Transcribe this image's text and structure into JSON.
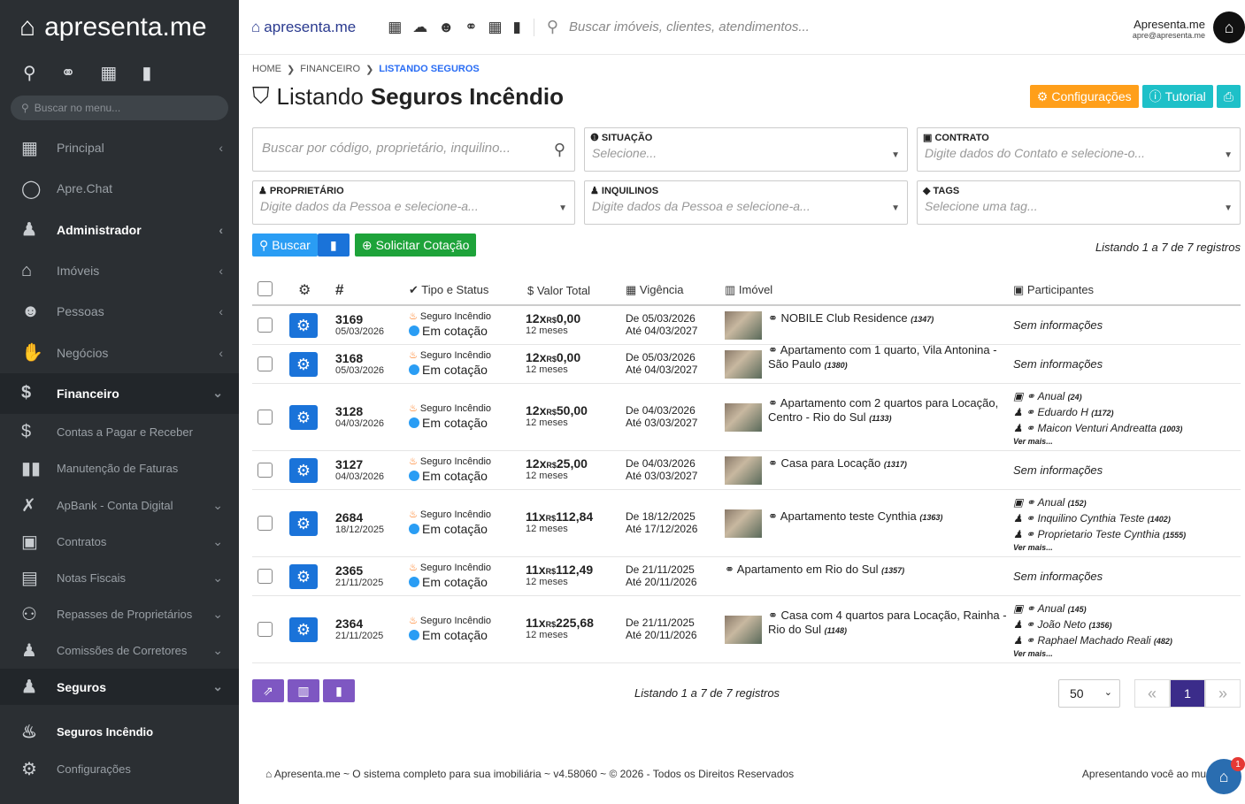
{
  "sidebar": {
    "logo": "apresenta.me",
    "search_placeholder": "Buscar no menu...",
    "items": [
      {
        "label": "Principal",
        "icon": "dashboard-icon",
        "glyph": "▦",
        "arrow": "‹",
        "style": ""
      },
      {
        "label": "Apre.Chat",
        "icon": "whatsapp-icon",
        "glyph": "◯",
        "arrow": "",
        "style": ""
      },
      {
        "label": "Administrador",
        "icon": "admin-icon",
        "glyph": "♟",
        "arrow": "‹",
        "style": "bold"
      },
      {
        "label": "Imóveis",
        "icon": "home-icon",
        "glyph": "⌂",
        "arrow": "‹",
        "style": ""
      },
      {
        "label": "Pessoas",
        "icon": "people-icon",
        "glyph": "☻",
        "arrow": "‹",
        "style": ""
      },
      {
        "label": "Negócios",
        "icon": "handshake-icon",
        "glyph": "✋",
        "arrow": "‹",
        "style": ""
      },
      {
        "label": "Financeiro",
        "icon": "money-icon",
        "glyph": "$",
        "arrow": "⌄",
        "style": "open"
      }
    ],
    "sub_items": [
      {
        "label": "Contas a Pagar e Receber",
        "icon": "dollar-icon",
        "glyph": "$",
        "arrow": ""
      },
      {
        "label": "Manutenção de Faturas",
        "icon": "barcode-icon",
        "glyph": "▮▮",
        "arrow": ""
      },
      {
        "label": "ApBank - Conta Digital",
        "icon": "bank-icon",
        "glyph": "✗",
        "arrow": "⌄"
      },
      {
        "label": "Contratos",
        "icon": "contract-icon",
        "glyph": "▣",
        "arrow": "⌄"
      },
      {
        "label": "Notas Fiscais",
        "icon": "invoice-icon",
        "glyph": "▤",
        "arrow": "⌄"
      },
      {
        "label": "Repasses de Proprietários",
        "icon": "transfer-icon",
        "glyph": "⚇",
        "arrow": "⌄"
      },
      {
        "label": "Comissões de Corretores",
        "icon": "commission-icon",
        "glyph": "♟",
        "arrow": "⌄"
      }
    ],
    "seguros": {
      "label": "Seguros",
      "arrow": "⌄"
    },
    "seguros_incendio": "Seguros Incêndio",
    "configuracoes": "Configurações"
  },
  "topbar": {
    "logo": "apresenta.me",
    "search_placeholder": "Buscar imóveis, clientes, atendimentos...",
    "user_name": "Apresenta.me",
    "user_email": "apre@apresenta.me"
  },
  "breadcrumb": {
    "home": "HOME",
    "sep": "❯",
    "fin": "FINANCEIRO",
    "cur": "LISTANDO SEGUROS"
  },
  "title": {
    "light": "Listando",
    "bold": "Seguros Incêndio"
  },
  "buttons": {
    "config": "Configurações",
    "tutorial": "Tutorial",
    "buscar": "Buscar",
    "cotacao": "Solicitar Cotação"
  },
  "filters": {
    "search_placeholder": "Buscar por código, proprietário, inquilino...",
    "situacao": {
      "label": "SITUAÇÃO",
      "ph": "Selecione..."
    },
    "contrato": {
      "label": "CONTRATO",
      "ph": "Digite dados do Contato e selecione-o..."
    },
    "proprietario": {
      "label": "PROPRIETÁRIO",
      "ph": "Digite dados da Pessoa e selecione-a..."
    },
    "inquilinos": {
      "label": "INQUILINOS",
      "ph": "Digite dados da Pessoa e selecione-a..."
    },
    "tags": {
      "label": "TAGS",
      "ph": "Selecione uma tag..."
    }
  },
  "count_text": "Listando 1 a 7 de 7 registros",
  "columns": {
    "hash": "#",
    "tipo": "Tipo e Status",
    "valor": "Valor Total",
    "vig": "Vigência",
    "imovel": "Imóvel",
    "part": "Participantes"
  },
  "rows": [
    {
      "code": "3169",
      "date": "05/03/2026",
      "tipo": "Seguro Incêndio",
      "status": "Em cotação",
      "parc": "12x",
      "cur": "R$",
      "val": "0,00",
      "meses": "12 meses",
      "de": "05/03/2026",
      "ate": "04/03/2027",
      "thumb": true,
      "imovel": "NOBILE Club Residence",
      "iid": "(1347)",
      "part": null,
      "h": 44
    },
    {
      "code": "3168",
      "date": "05/03/2026",
      "tipo": "Seguro Incêndio",
      "status": "Em cotação",
      "parc": "12x",
      "cur": "R$",
      "val": "0,00",
      "meses": "12 meses",
      "de": "05/03/2026",
      "ate": "04/03/2027",
      "thumb": true,
      "imovel": "Apartamento com 1 quarto, Vila Antonina - São Paulo",
      "iid": "(1380)",
      "part": null,
      "h": 44
    },
    {
      "code": "3128",
      "date": "04/03/2026",
      "tipo": "Seguro Incêndio",
      "status": "Em cotação",
      "parc": "12x",
      "cur": "R$",
      "val": "50,00",
      "meses": "12 meses",
      "de": "04/03/2026",
      "ate": "03/03/2027",
      "thumb": true,
      "imovel": "Apartamento com 2 quartos para Locação, Centro - Rio do Sul",
      "iid": "(1133)",
      "part": [
        [
          "Anual",
          "(24)"
        ],
        [
          "Eduardo H",
          "(1172)"
        ],
        [
          "Maicon Venturi Andreatta",
          "(1003)"
        ]
      ],
      "h": 76
    },
    {
      "code": "3127",
      "date": "04/03/2026",
      "tipo": "Seguro Incêndio",
      "status": "Em cotação",
      "parc": "12x",
      "cur": "R$",
      "val": "25,00",
      "meses": "12 meses",
      "de": "04/03/2026",
      "ate": "03/03/2027",
      "thumb": true,
      "imovel": "Casa para Locação",
      "iid": "(1317)",
      "part": null,
      "h": 44
    },
    {
      "code": "2684",
      "date": "18/12/2025",
      "tipo": "Seguro Incêndio",
      "status": "Em cotação",
      "parc": "11x",
      "cur": "R$",
      "val": "112,84",
      "meses": "12 meses",
      "de": "18/12/2025",
      "ate": "17/12/2026",
      "thumb": true,
      "imovel": "Apartamento teste Cynthia",
      "iid": "(1363)",
      "part": [
        [
          "Anual",
          "(152)"
        ],
        [
          "Inquilino Cynthia Teste",
          "(1402)"
        ],
        [
          "Proprietario Teste Cynthia",
          "(1555)"
        ]
      ],
      "h": 76
    },
    {
      "code": "2365",
      "date": "21/11/2025",
      "tipo": "Seguro Incêndio",
      "status": "Em cotação",
      "parc": "11x",
      "cur": "R$",
      "val": "112,49",
      "meses": "12 meses",
      "de": "21/11/2025",
      "ate": "20/11/2026",
      "thumb": false,
      "imovel": "Apartamento em Rio do Sul",
      "iid": "(1357)",
      "part": null,
      "h": 44
    },
    {
      "code": "2364",
      "date": "21/11/2025",
      "tipo": "Seguro Incêndio",
      "status": "Em cotação",
      "parc": "11x",
      "cur": "R$",
      "val": "225,68",
      "meses": "12 meses",
      "de": "21/11/2025",
      "ate": "20/11/2026",
      "thumb": true,
      "imovel": "Casa com 4 quartos para Locação, Rainha - Rio do Sul",
      "iid": "(1148)",
      "part": [
        [
          "Anual",
          "(145)"
        ],
        [
          "João Neto",
          "(1356)"
        ],
        [
          "Raphael Machado Reali",
          "(482)"
        ]
      ],
      "h": 76
    }
  ],
  "labels": {
    "de": "De",
    "ate": "Até",
    "sem": "Sem informações",
    "vermais": "Ver mais..."
  },
  "page_size": "50",
  "page": "1",
  "footer": "Apresenta.me ~ O sistema completo para sua imobiliária ~ v4.58060 ~ © 2026 - Todos os Direitos Reservados",
  "footer_right": "Apresentando você ao mu",
  "chat_badge": "1"
}
